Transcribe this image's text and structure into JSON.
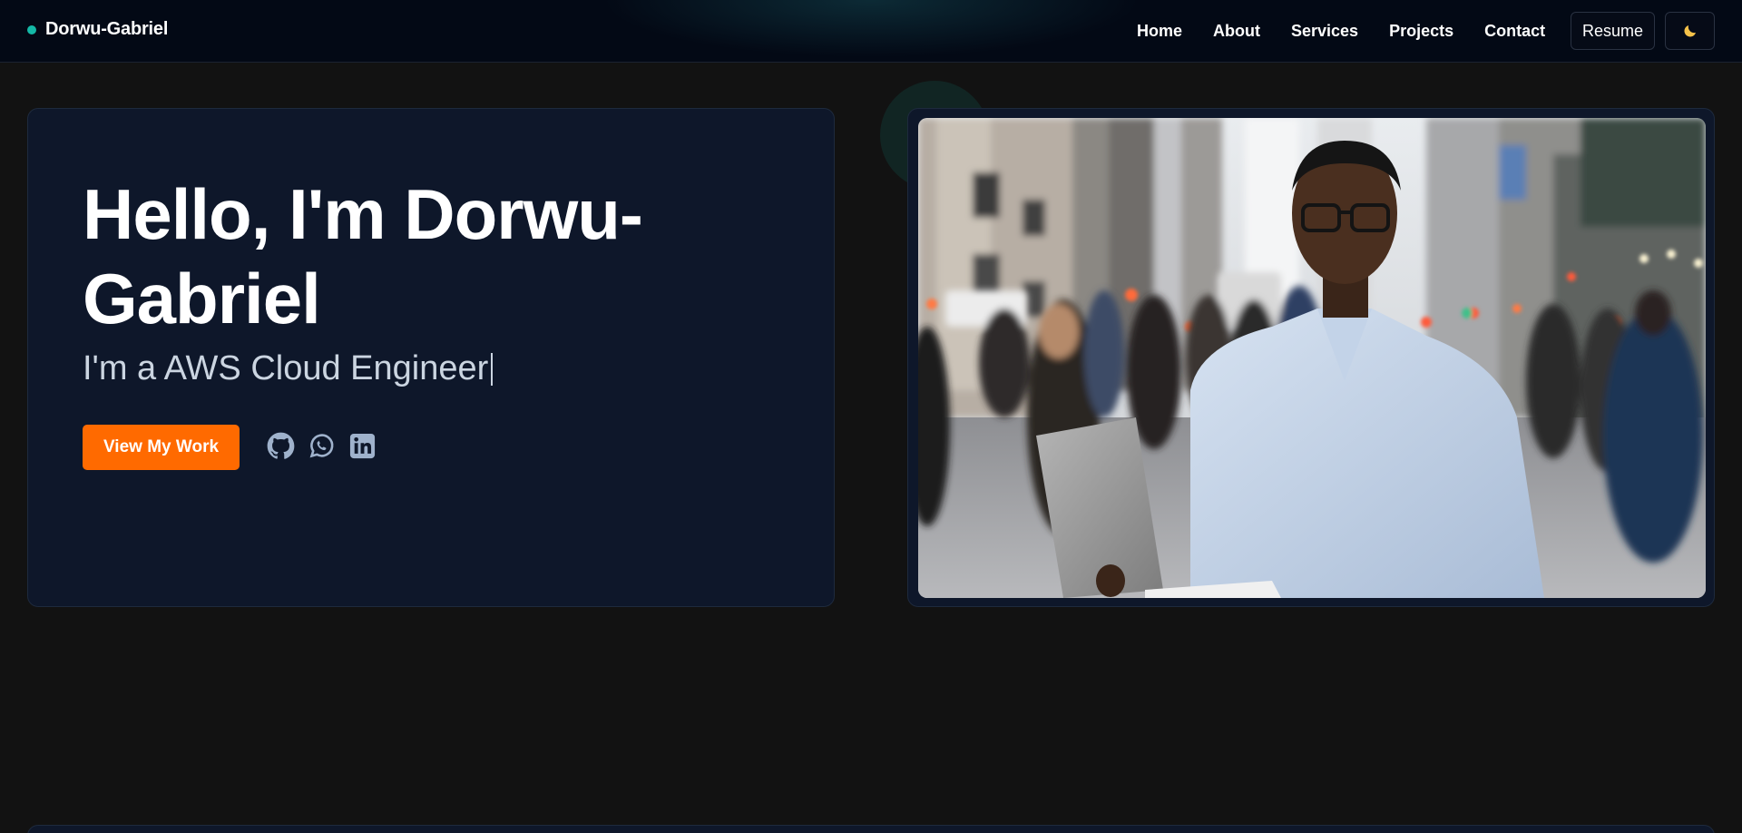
{
  "nav": {
    "brand": "Dorwu-Gabriel",
    "links": [
      {
        "label": "Home"
      },
      {
        "label": "About"
      },
      {
        "label": "Services"
      },
      {
        "label": "Projects"
      },
      {
        "label": "Contact"
      }
    ],
    "resume_label": "Resume",
    "theme_icon": "moon-icon"
  },
  "hero": {
    "title_line1": "Hello, I'm Dorwu-",
    "title_line2": "Gabriel",
    "subtitle": "I'm a AWS Cloud Engineer",
    "cta_label": "View My Work",
    "socials": [
      {
        "icon": "github-icon"
      },
      {
        "icon": "whatsapp-icon"
      },
      {
        "icon": "linkedin-icon"
      }
    ]
  },
  "colors": {
    "accent": "#ff6a00",
    "brand_dot": "#14b8a6",
    "card_bg": "#0e172a",
    "page_bg": "#121212"
  }
}
